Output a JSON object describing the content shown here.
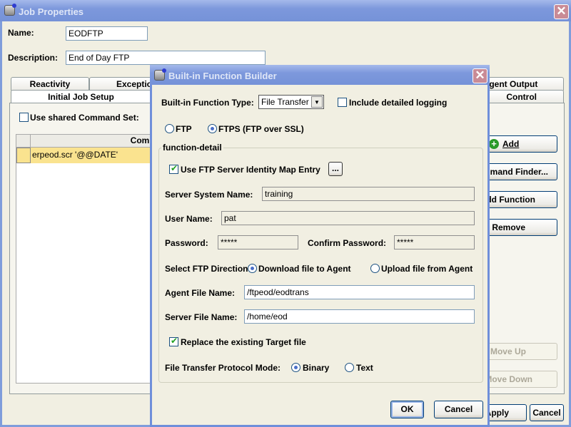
{
  "outer": {
    "title": "Job Properties",
    "name_label": "Name:",
    "name_value": "EODFTP",
    "description_label": "Description:",
    "description_value": "End of Day FTP",
    "tabs_row1": [
      "Reactivity",
      "Exceptions",
      "Agent Output"
    ],
    "tabs_row2": [
      "Initial Job Setup",
      "Control"
    ],
    "shared_command_label": "Use shared Command Set:",
    "table": {
      "header": "Command",
      "rows": [
        "erpeod.scr '@@DATE'"
      ]
    },
    "buttons": {
      "add": "Add",
      "command_finder": "Command Finder...",
      "add_function": "Add Function",
      "remove": "Remove",
      "move_up": "Move Up",
      "move_down": "Move Down",
      "apply": "Apply",
      "cancel": "Cancel"
    }
  },
  "dialog": {
    "title": "Built-in Function Builder",
    "type_label": "Built-in Function Type:",
    "type_value": "File Transfer",
    "logging_label": "Include detailed logging",
    "logging_checked": false,
    "protocol_options": [
      "FTP",
      "FTPS (FTP over SSL)"
    ],
    "protocol_selected": "FTPS (FTP over SSL)",
    "group_label": "function-detail",
    "identity_map_label": "Use FTP Server Identity Map Entry",
    "identity_map_checked": true,
    "browse_label": "...",
    "server_system_label": "Server System Name:",
    "server_system_value": "training",
    "user_label": "User Name:",
    "user_value": "pat",
    "password_label": "Password:",
    "password_value": "*****",
    "confirm_label": "Confirm Password:",
    "confirm_value": "*****",
    "direction_label": "Select FTP Direction:",
    "direction_options": [
      "Download file to Agent",
      "Upload file from Agent"
    ],
    "direction_selected": "Download file to Agent",
    "agent_file_label": "Agent File Name:",
    "agent_file_value": "/ftpeod/eodtrans",
    "server_file_label": "Server File Name:",
    "server_file_value": "/home/eod",
    "replace_label": "Replace the existing Target file",
    "replace_checked": true,
    "mode_label": "File Transfer Protocol Mode:",
    "mode_options": [
      "Binary",
      "Text"
    ],
    "mode_selected": "Binary",
    "ok": "OK",
    "cancel": "Cancel"
  },
  "colors": {
    "title_bar": "#7d98dc",
    "selected_row": "#fae38f",
    "window_bg": "#f1efe2"
  }
}
